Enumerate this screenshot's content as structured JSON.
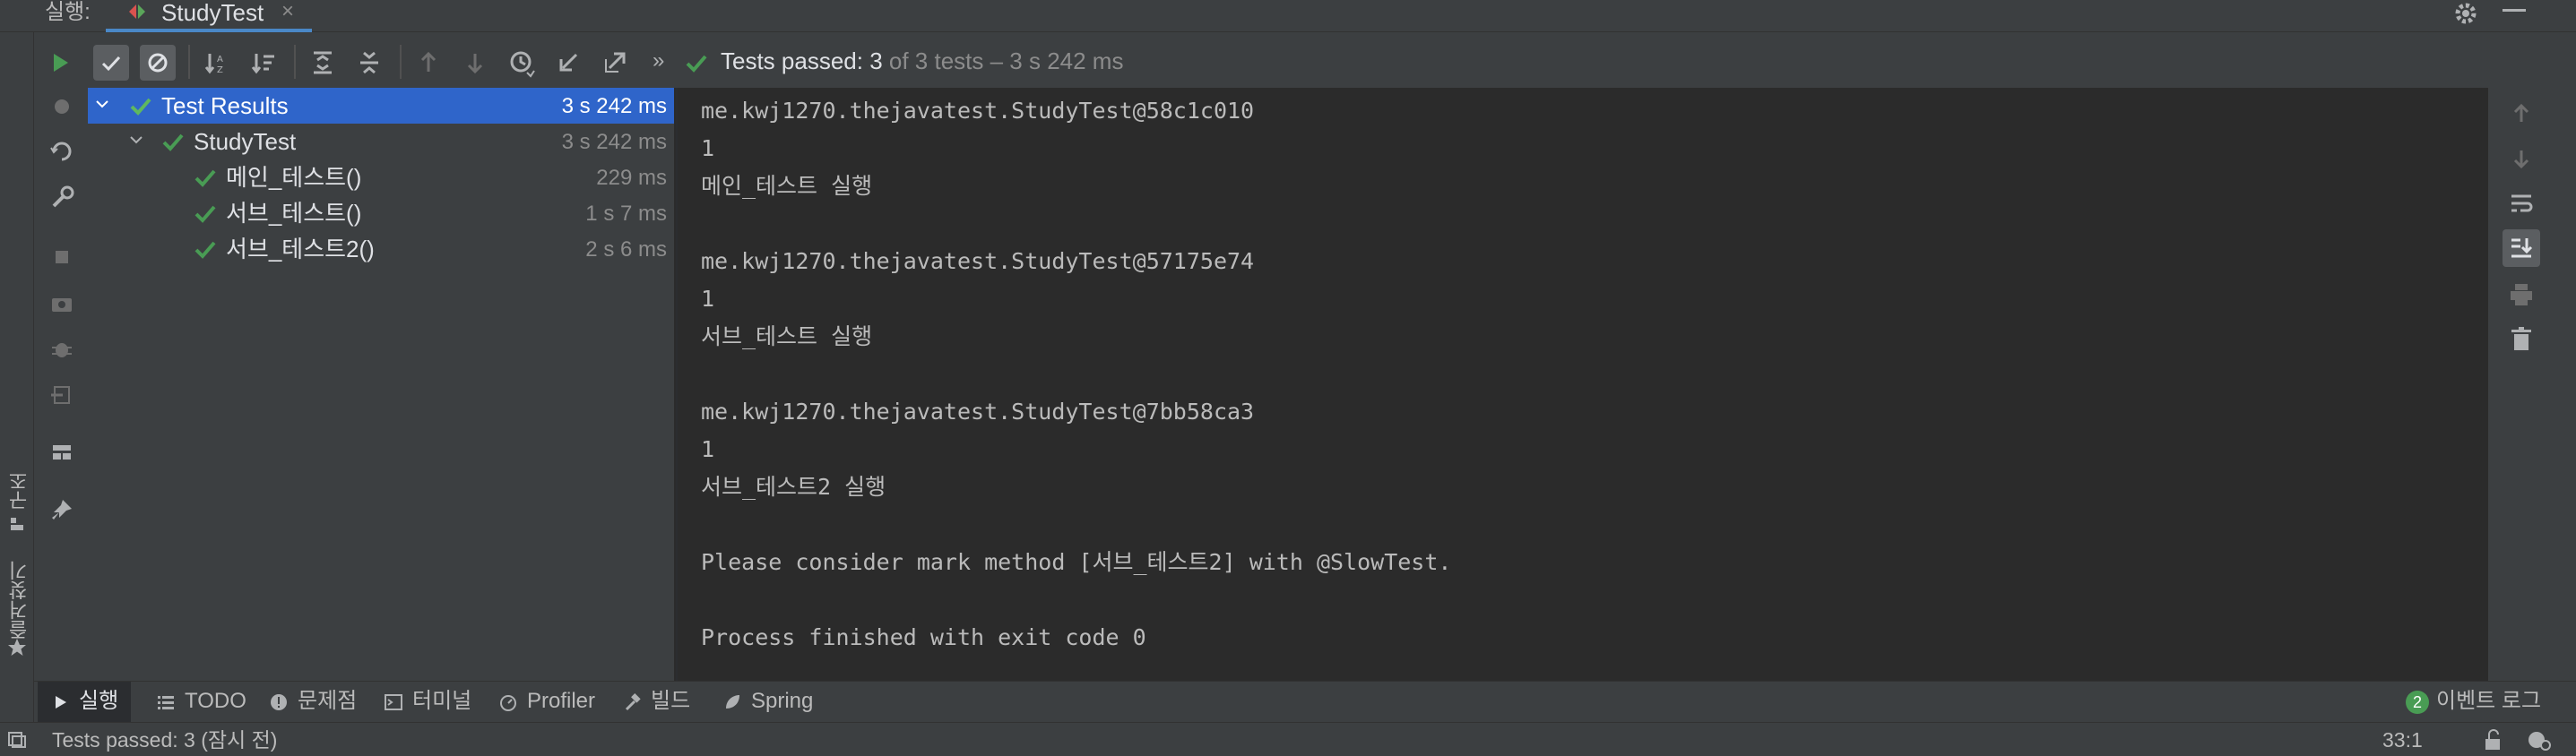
{
  "titlebar": {
    "run_label": "실행:",
    "tab_title": "StudyTest",
    "tab_close": "×"
  },
  "leftstrip": {
    "structure_label": "구조",
    "favorites_label": "즐겨찾기"
  },
  "toolbar": {
    "overflow": "»",
    "summary_passed": "Tests passed: 3",
    "summary_rest": " of 3 tests – 3 s 242 ms"
  },
  "tree": {
    "rows": [
      {
        "name": "Test Results",
        "duration": "3 s 242 ms"
      },
      {
        "name": "StudyTest",
        "duration": "3 s 242 ms"
      },
      {
        "name": "메인_테스트()",
        "duration": "229 ms"
      },
      {
        "name": "서브_테스트()",
        "duration": "1 s 7 ms"
      },
      {
        "name": "서브_테스트2()",
        "duration": "2 s 6 ms"
      }
    ]
  },
  "console": {
    "lines": [
      "me.kwj1270.thejavatest.StudyTest@58c1c010",
      "1",
      "메인_테스트 실행",
      "",
      "me.kwj1270.thejavatest.StudyTest@57175e74",
      "1",
      "서브_테스트 실행",
      "",
      "me.kwj1270.thejavatest.StudyTest@7bb58ca3",
      "1",
      "서브_테스트2 실행",
      "",
      "Please consider mark method [서브_테스트2] with @SlowTest.",
      "",
      "Process finished with exit code 0"
    ]
  },
  "bottomtabs": {
    "run": "실행",
    "todo": "TODO",
    "problems": "문제점",
    "terminal": "터미널",
    "profiler": "Profiler",
    "build": "빌드",
    "spring": "Spring",
    "events_count": "2",
    "events": "이벤트 로그"
  },
  "statusbar": {
    "text": "Tests passed: 3 (잠시 전)",
    "cursor": "33:1"
  },
  "colors": {
    "accent": "#2f65ca",
    "success": "#499c54",
    "run_green": "#499c54"
  }
}
